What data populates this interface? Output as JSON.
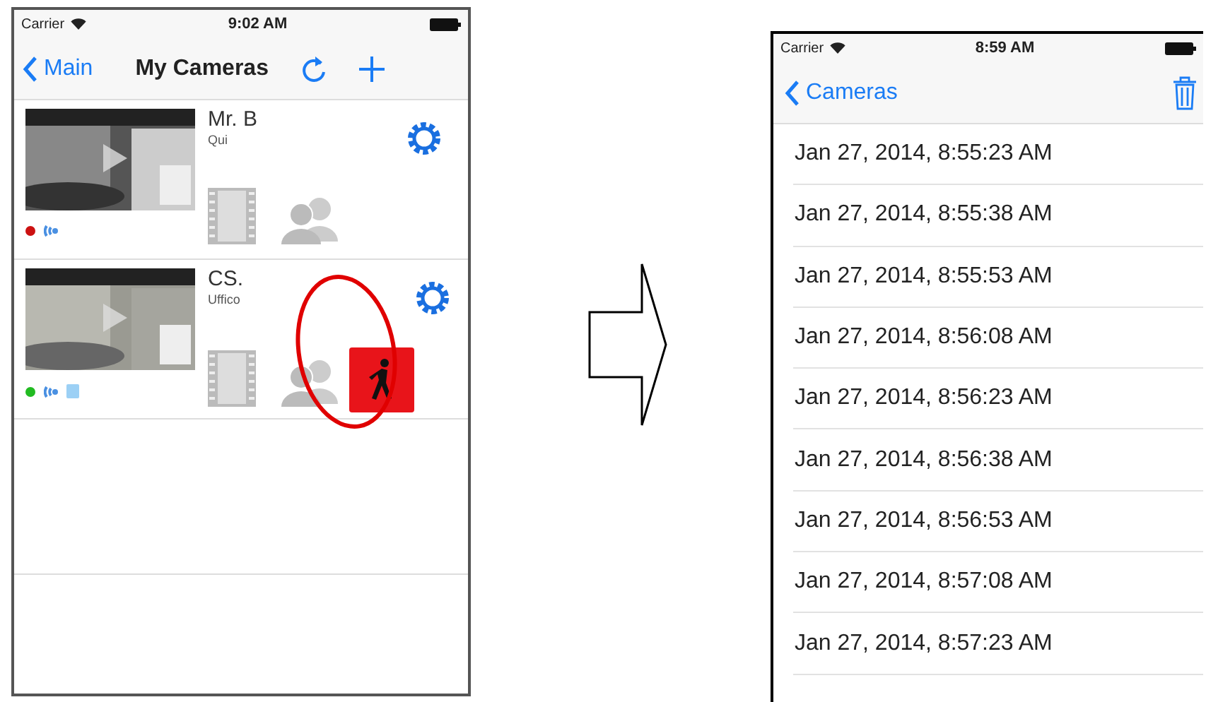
{
  "left_screen": {
    "status_bar": {
      "carrier": "Carrier",
      "time": "9:02 AM"
    },
    "nav": {
      "back": "Main",
      "title": "My Cameras"
    },
    "cameras": [
      {
        "name": "Mr. B",
        "location": "Qui",
        "color": "#cc1111",
        "motion_alert": false,
        "highlighted": false
      },
      {
        "name": "CS.",
        "location": "Uffico",
        "color": "#22bb22",
        "motion_alert": true,
        "highlighted": true
      }
    ]
  },
  "right_screen": {
    "status_bar": {
      "carrier": "Carrier",
      "time": "8:59 AM"
    },
    "nav": {
      "back": "Cameras"
    },
    "recordings": [
      "Jan 27, 2014, 8:55:23 AM",
      "Jan 27, 2014, 8:55:38 AM",
      "Jan 27, 2014, 8:55:53 AM",
      "Jan 27, 2014, 8:56:08 AM",
      "Jan 27, 2014, 8:56:23 AM",
      "Jan 27, 2014, 8:56:38 AM",
      "Jan 27, 2014, 8:56:53 AM",
      "Jan 27, 2014, 8:57:08 AM",
      "Jan 27, 2014, 8:57:23 AM"
    ]
  }
}
